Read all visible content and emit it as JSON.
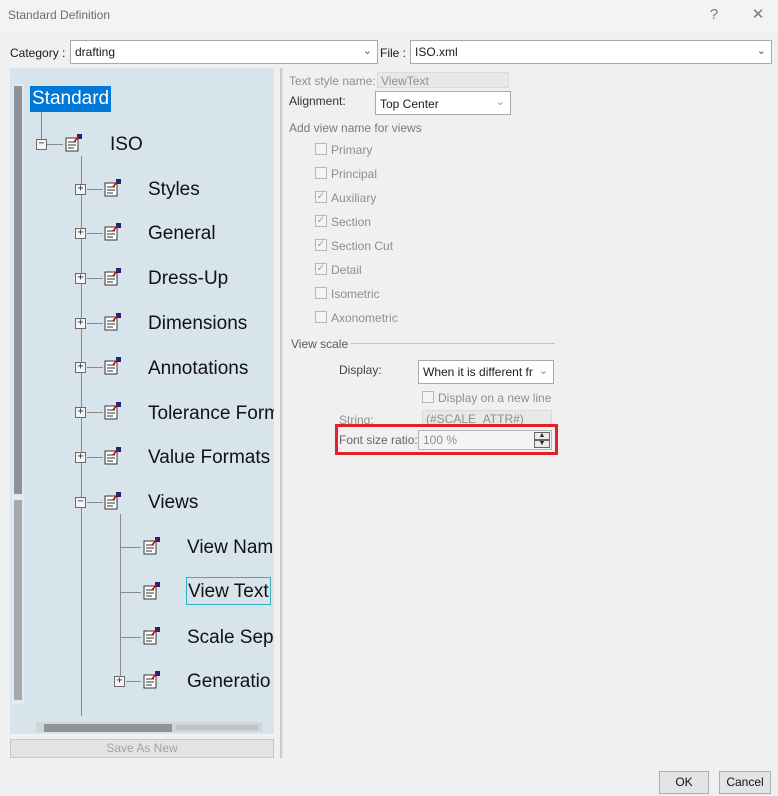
{
  "window": {
    "title": "Standard Definition",
    "help_icon": "?",
    "close_icon": "close-icon"
  },
  "top": {
    "category_label": "Category :",
    "category_value": "drafting",
    "file_label": "File :",
    "file_value": "ISO.xml"
  },
  "tree": {
    "root": "Standard",
    "iso": "ISO",
    "items": [
      "Styles",
      "General",
      "Dress-Up",
      "Dimensions",
      "Annotations",
      "Tolerance Form",
      "Value Formats",
      "Views"
    ],
    "views_children": [
      "View Nam",
      "View Text",
      "Scale Sepa",
      "Generatio"
    ],
    "save_button": "Save As New"
  },
  "props": {
    "text_style_label": "Text style name:",
    "text_style_value": "ViewText",
    "alignment_label": "Alignment:",
    "alignment_value": "Top Center",
    "add_view_name_label": "Add view name for views",
    "view_checkboxes": [
      {
        "label": "Primary",
        "checked": false
      },
      {
        "label": "Principal",
        "checked": false
      },
      {
        "label": "Auxiliary",
        "checked": true
      },
      {
        "label": "Section",
        "checked": true
      },
      {
        "label": "Section Cut",
        "checked": true
      },
      {
        "label": "Detail",
        "checked": true
      },
      {
        "label": "Isometric",
        "checked": false
      },
      {
        "label": "Axonometric",
        "checked": false
      }
    ],
    "view_scale_label": "View scale",
    "display_label": "Display:",
    "display_value": "When it is different fr",
    "new_line_label": "Display on a new line",
    "string_label": "String:",
    "string_value": "(#SCALE_ATTR#)",
    "font_ratio_label": "Font size ratio:",
    "font_ratio_value": "100 %"
  },
  "buttons": {
    "ok": "OK",
    "cancel": "Cancel"
  },
  "colors": {
    "selection": "#0078d7",
    "highlight_box": "#e0202a",
    "tree_bg": "#d8e4ec"
  }
}
